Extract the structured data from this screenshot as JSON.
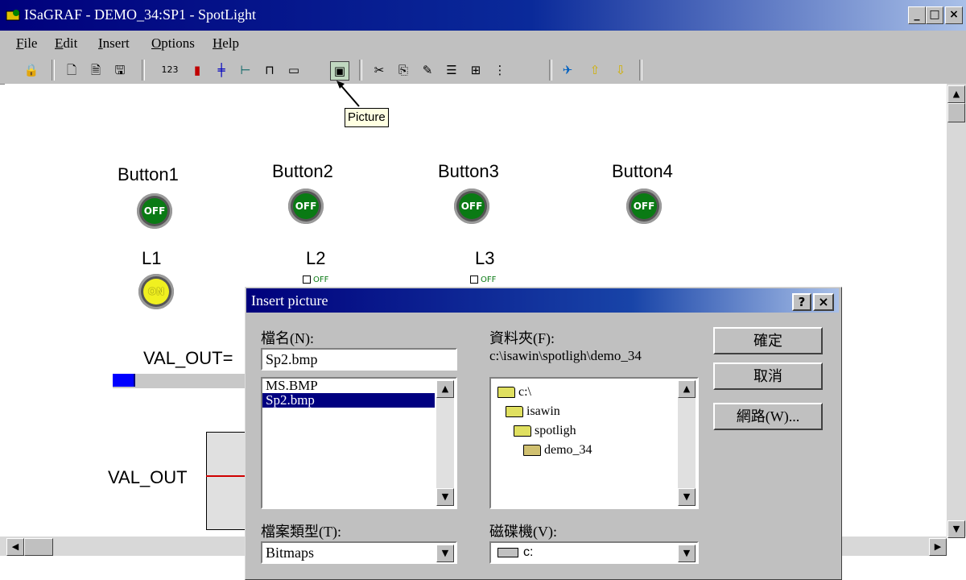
{
  "window": {
    "title": "ISaGRAF - DEMO_34:SP1 - SpotLight",
    "controls": {
      "minimize": "_",
      "maximize": "□",
      "close": "×"
    }
  },
  "menu": [
    {
      "label": "File",
      "mnemonic": "F"
    },
    {
      "label": "Edit",
      "mnemonic": "E"
    },
    {
      "label": "Insert",
      "mnemonic": "I"
    },
    {
      "label": "Options",
      "mnemonic": "O"
    },
    {
      "label": "Help",
      "mnemonic": "H"
    }
  ],
  "toolbar": {
    "items": [
      "lock-icon",
      "new-icon",
      "open-icon",
      "save-icon",
      "number-icon",
      "bar-icon",
      "slider-icon",
      "switch-icon",
      "pulse-icon",
      "edit-box-icon",
      "picture-icon",
      "cut-icon",
      "copy-icon",
      "paste-icon",
      "properties-icon",
      "grid-icon",
      "align-icon",
      "tools-icon",
      "up-arrow-icon",
      "down-arrow-icon"
    ],
    "number_label": "123"
  },
  "tooltip": "Picture",
  "canvas": {
    "buttons": [
      {
        "label": "Button1",
        "state": "OFF"
      },
      {
        "label": "Button2",
        "state": "OFF"
      },
      {
        "label": "Button3",
        "state": "OFF"
      },
      {
        "label": "Button4",
        "state": "OFF"
      }
    ],
    "lamps": [
      {
        "label": "L1",
        "state": "ON"
      },
      {
        "label": "L2",
        "state": "OFF"
      },
      {
        "label": "L3",
        "state": "OFF"
      }
    ],
    "val_out_label": "VAL_OUT=",
    "val_out_trend_label": "VAL_OUT"
  },
  "dialog": {
    "title": "Insert picture",
    "help_btn": "?",
    "close_btn": "×",
    "filename_label": "檔名(N):",
    "filename_value": "Sp2.bmp",
    "files": [
      "MS.BMP",
      "Sp2.bmp"
    ],
    "selected_file": 1,
    "folder_label": "資料夾(F):",
    "folder_path": "c:\\isawin\\spotligh\\demo_34",
    "folders": [
      "c:\\",
      "isawin",
      "spotligh",
      "demo_34"
    ],
    "ok": "確定",
    "cancel": "取消",
    "network": "網路(W)...",
    "filetype_label": "檔案類型(T):",
    "filetype_value": "Bitmaps",
    "drive_label": "磁碟機(V):",
    "drive_value": "c:"
  }
}
